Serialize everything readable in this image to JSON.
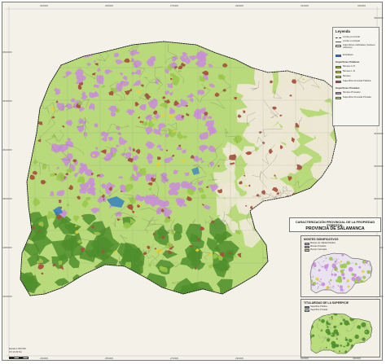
{
  "legend": {
    "title": "Leyenda",
    "lines": [
      {
        "label": "Límite provincial",
        "style": "dash"
      },
      {
        "label": "Límite municipal",
        "style": "solid"
      },
      {
        "label": "Superficies artificiales (núcleos urbanos)",
        "style": "box"
      }
    ],
    "water_label": "Embalses",
    "water_color": "#2a79c7",
    "public_title": "Superficies Públicas",
    "public_items": [
      {
        "label": "Montes U.P.",
        "color": "#9ac84a"
      },
      {
        "label": "Montes L.D.",
        "color": "#e6d23a"
      },
      {
        "label": "Montes",
        "color": "#b5d96b"
      },
      {
        "label": "Superficie Forestal Pública",
        "color": "#a5523f"
      }
    ],
    "private_title": "Superficies Privadas",
    "private_items": [
      {
        "label": "Montes Privados",
        "color": "#c98ed7"
      },
      {
        "label": "Superficie Forestal Privada",
        "color": "#b8da7a"
      }
    ]
  },
  "title_box": {
    "line1": "CARACTERIZACIÓN PROVINCIAL DE LA PROPIEDAD FORESTAL",
    "line2": "PROVINCIA DE SALAMANCA"
  },
  "inset1": {
    "title": "MONTES SIGNIFICATIVOS",
    "items": [
      {
        "label": "Montes de Utilidad Pública",
        "color": "#9ac84a"
      },
      {
        "label": "Montes Privados",
        "color": "#c98ed7"
      },
      {
        "label": "Montes Vecinales",
        "color": "#e6d23a"
      }
    ]
  },
  "inset2": {
    "title": "TITULARIDAD DE LA SUPERFICIE",
    "items": [
      {
        "label": "Superficie Pública",
        "color": "#4e8e2c"
      },
      {
        "label": "Superficie Privada",
        "color": "#b9dd7c"
      }
    ]
  },
  "scale": {
    "lines": [
      "Escala 1:400.000",
      "0  5  10  20 Km"
    ]
  },
  "grid": {
    "top": [
      "230000",
      "250000",
      "270000",
      "290000",
      "310000",
      "330000"
    ],
    "bottom": [
      "230000",
      "250000",
      "270000",
      "290000",
      "310000",
      "330000"
    ],
    "left": [
      "4560000",
      "4540000",
      "4520000",
      "4500000",
      "4480000",
      "4460000"
    ],
    "right": [
      "4560000",
      "4540000",
      "4520000",
      "4500000",
      "4480000",
      "4460000"
    ]
  },
  "colors": {
    "background": "#f4f1e9",
    "private_forest": "#b8da7a",
    "private_mount": "#c98ed7",
    "public_forest": "#a5523f",
    "public_surface": "#4e8e2c",
    "montes": "#9ac84a",
    "ld": "#e6d23a",
    "east_unforested": "#ede8d6",
    "water": "#2a79c7"
  }
}
